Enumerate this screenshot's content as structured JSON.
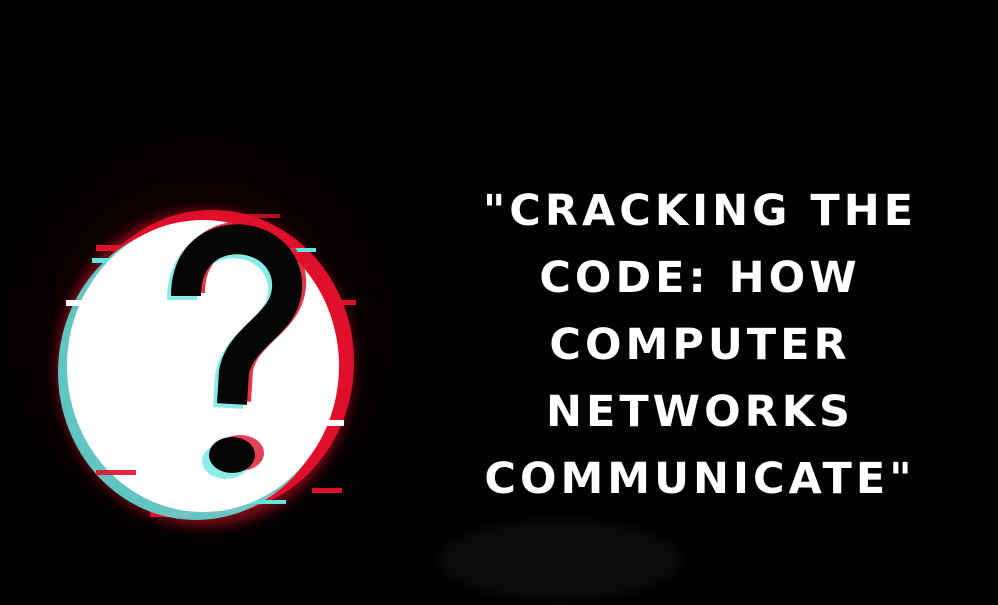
{
  "title_lines": [
    "\"CRACKING THE",
    "CODE: HOW",
    "COMPUTER",
    "NETWORKS",
    "COMMUNICATE\""
  ],
  "colors": {
    "background": "#020202",
    "circle": "#ffffff",
    "glow_red": "#e0102a",
    "glow_cyan": "#5fe6e0",
    "question_mark": "#000000",
    "title_text": "#ffffff"
  },
  "icon": "question-mark-icon"
}
